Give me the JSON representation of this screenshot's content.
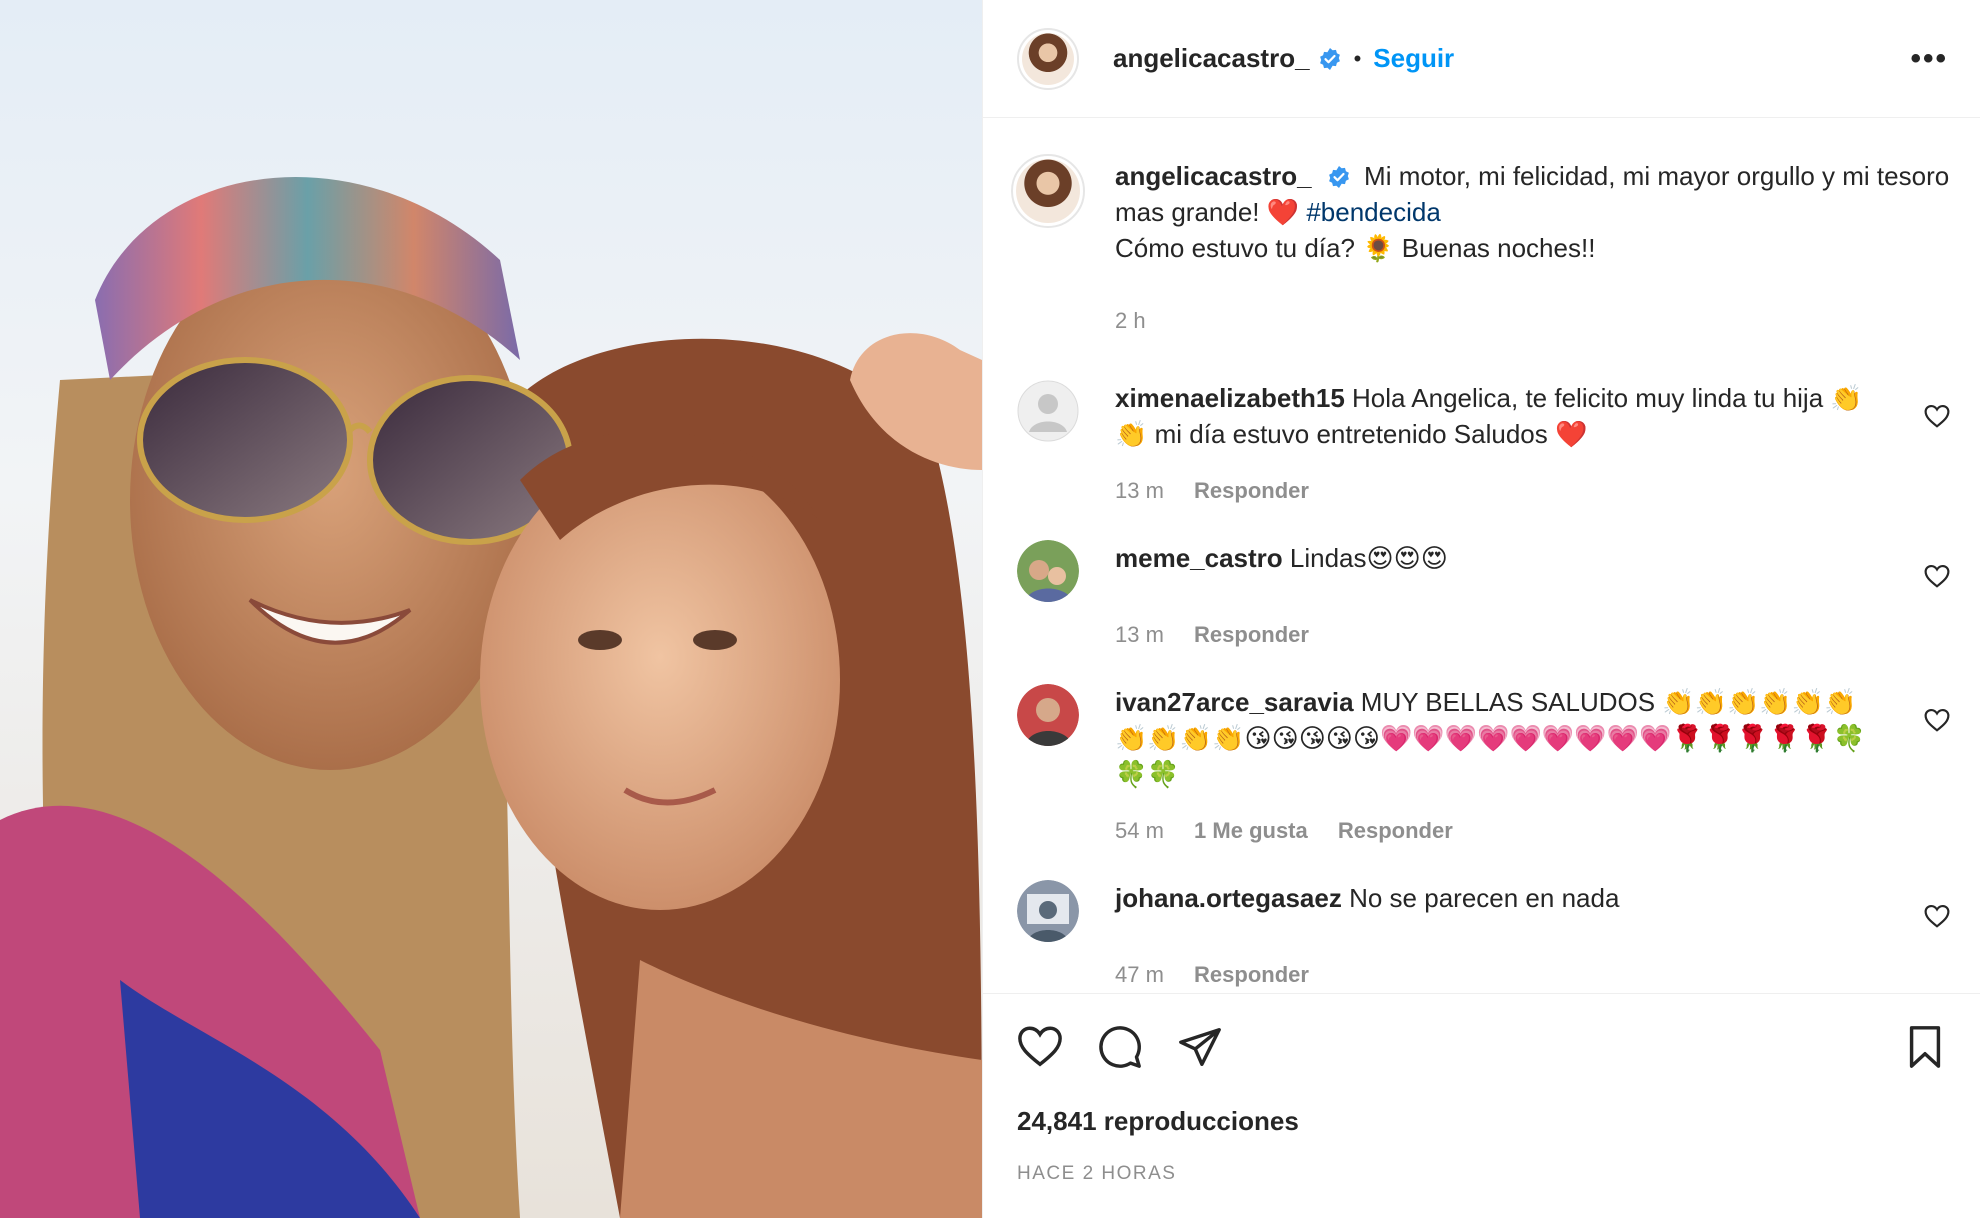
{
  "post": {
    "username": "angelicacastro_",
    "follow_label": "Seguir",
    "separator": "•",
    "more_label": "•••",
    "caption": {
      "username": "angelicacastro_",
      "text_before": "Mi motor, mi felicidad, mi mayor orgullo y mi tesoro mas grande! ❤️ ",
      "hashtag": "#bendecida",
      "text_after": "Cómo estuvo tu día? 🌻 Buenas noches!!",
      "time": "2 h"
    },
    "comments": [
      {
        "username": "ximenaelizabeth15",
        "text": "Hola Angelica, te felicito muy linda tu hija 👏👏 mi día estuvo entretenido Saludos ❤️",
        "time": "13 m",
        "likes": "",
        "reply": "Responder"
      },
      {
        "username": "meme_castro",
        "text": "Lindas😍😍😍",
        "time": "13 m",
        "likes": "",
        "reply": "Responder"
      },
      {
        "username": "ivan27arce_saravia",
        "text": "MUY BELLAS SALUDOS 👏👏👏👏👏👏👏👏👏👏😘😘😘😘😘💗💗💗💗💗💗💗💗💗🌹🌹🌹🌹🌹🍀🍀🍀",
        "time": "54 m",
        "likes": "1 Me gusta",
        "reply": "Responder"
      },
      {
        "username": "johana.ortegasaez",
        "text": "No se parecen en nada",
        "time": "47 m",
        "likes": "",
        "reply": "Responder"
      }
    ],
    "views": "24,841 reproducciones",
    "posted": "HACE 2 HORAS"
  },
  "colors": {
    "accent": "#0095f6",
    "hashtag": "#00376b",
    "muted": "#8e8e8e",
    "text": "#262626"
  },
  "icons": [
    "verified-badge-icon",
    "heart-icon",
    "comment-icon",
    "share-icon",
    "bookmark-icon",
    "more-options-icon"
  ]
}
